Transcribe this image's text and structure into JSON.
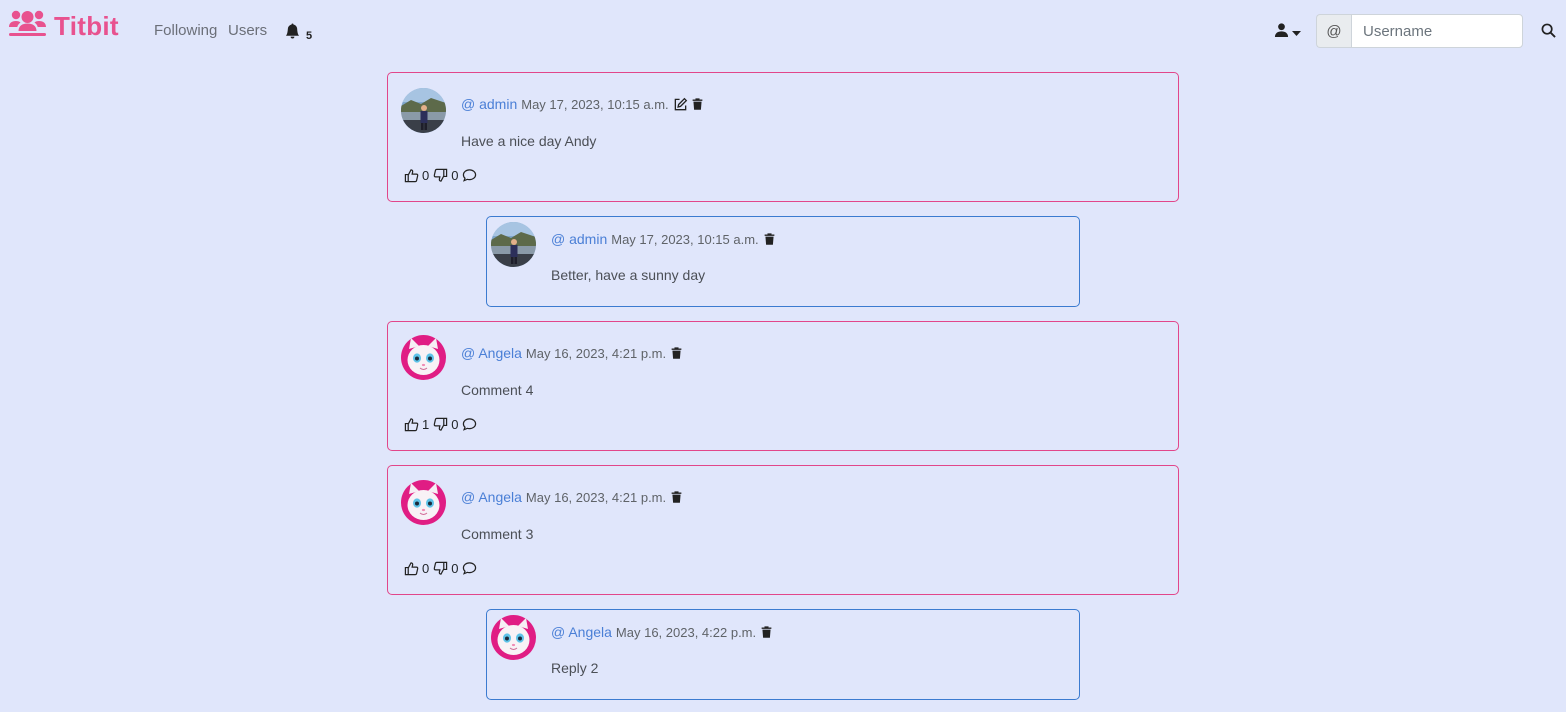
{
  "brand": {
    "name": "Titbit",
    "color": "#e8528f"
  },
  "nav": {
    "following": "Following",
    "users": "Users",
    "notification_count": "5"
  },
  "search": {
    "prefix": "@",
    "placeholder": "Username",
    "value": ""
  },
  "comments": [
    {
      "author": "@ admin",
      "date": "May 17, 2023, 10:15 a.m.",
      "text": "Have a nice day Andy",
      "likes": "0",
      "dislikes": "0",
      "avatar": "landscape-photo-avatar",
      "editable": true,
      "reply": {
        "author": "@ admin",
        "date": "May 17, 2023, 10:15 a.m.",
        "text": "Better, have a sunny day",
        "avatar": "landscape-photo-avatar"
      }
    },
    {
      "author": "@ Angela",
      "date": "May 16, 2023, 4:21 p.m.",
      "text": "Comment 4",
      "likes": "1",
      "dislikes": "0",
      "avatar": "pink-cat-avatar"
    },
    {
      "author": "@ Angela",
      "date": "May 16, 2023, 4:21 p.m.",
      "text": "Comment 3",
      "likes": "0",
      "dislikes": "0",
      "avatar": "pink-cat-avatar",
      "reply": {
        "author": "@ Angela",
        "date": "May 16, 2023, 4:22 p.m.",
        "text": "Reply 2",
        "avatar": "pink-cat-avatar"
      }
    }
  ],
  "colors": {
    "page_background": "#e0e6fb",
    "comment_border": "#e2468a",
    "reply_border": "#3b7bd0",
    "author_link": "#4a7fd6"
  }
}
